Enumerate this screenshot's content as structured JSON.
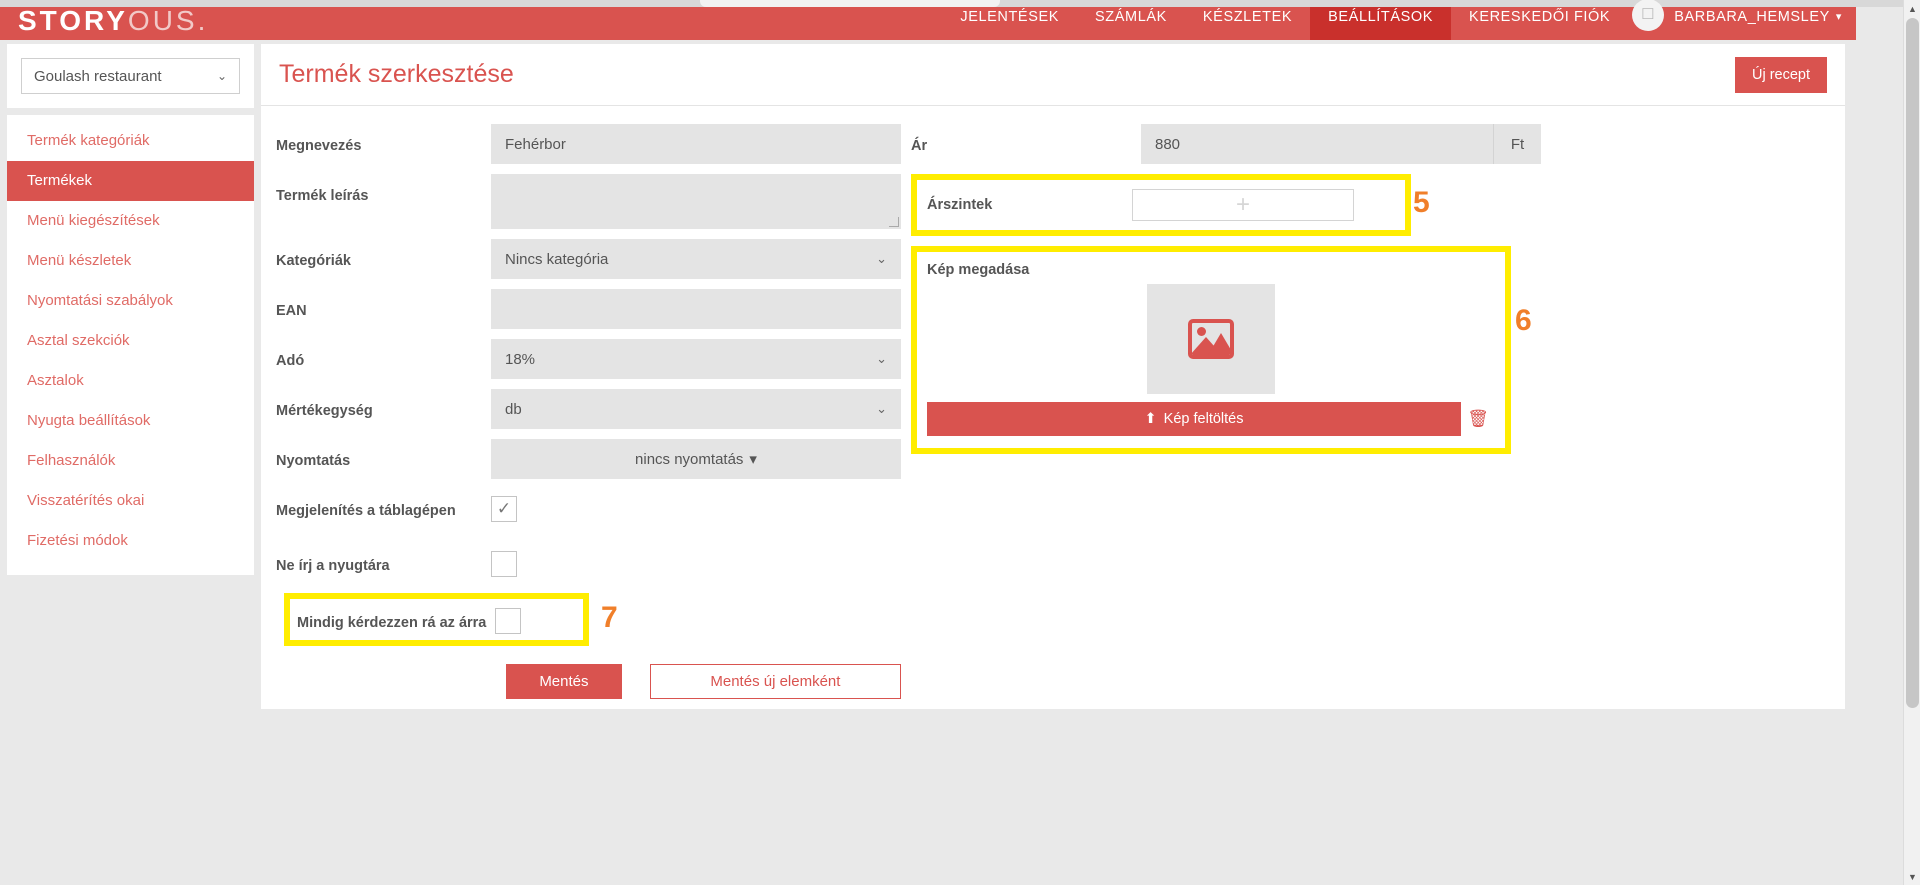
{
  "brand": {
    "logo_bold": "STORY",
    "logo_light": "OUS.",
    "accent": "#d9534f",
    "highlight": "#ffed00",
    "annotation_color": "#f07f2a"
  },
  "topnav": {
    "items": [
      {
        "label": "JELENTÉSEK",
        "active": false
      },
      {
        "label": "SZÁMLÁK",
        "active": false
      },
      {
        "label": "KÉSZLETEK",
        "active": false
      },
      {
        "label": "BEÁLLÍTÁSOK",
        "active": true
      },
      {
        "label": "KERESKEDŐI FIÓK",
        "active": false
      }
    ],
    "user": {
      "name": "BARBARA_HEMSLEY",
      "avatar_icon": "broken-image-icon",
      "caret": "▾"
    }
  },
  "restaurant_select": {
    "value": "Goulash restaurant",
    "caret": "⌄"
  },
  "sidebar": {
    "items": [
      {
        "label": "Termék kategóriák",
        "active": false
      },
      {
        "label": "Termékek",
        "active": true
      },
      {
        "label": "Menü kiegészítések",
        "active": false
      },
      {
        "label": "Menü készletek",
        "active": false
      },
      {
        "label": "Nyomtatási szabályok",
        "active": false
      },
      {
        "label": "Asztal szekciók",
        "active": false
      },
      {
        "label": "Asztalok",
        "active": false
      },
      {
        "label": "Nyugta beállítások",
        "active": false
      },
      {
        "label": "Felhasználók",
        "active": false
      },
      {
        "label": "Visszatérítés okai",
        "active": false
      },
      {
        "label": "Fizetési módok",
        "active": false
      }
    ]
  },
  "header": {
    "title": "Termék szerkesztése",
    "new_recipe_button": "Új recept"
  },
  "form": {
    "name": {
      "label": "Megnevezés",
      "value": "Fehérbor"
    },
    "description": {
      "label": "Termék leírás",
      "value": ""
    },
    "categories": {
      "label": "Kategóriák",
      "value": "Nincs kategória",
      "caret": "⌄"
    },
    "ean": {
      "label": "EAN",
      "value": ""
    },
    "tax": {
      "label": "Adó",
      "value": "18%",
      "caret": "⌄"
    },
    "unit": {
      "label": "Mértékegység",
      "value": "db",
      "caret": "⌄"
    },
    "printing": {
      "label": "Nyomtatás",
      "value": "nincs nyomtatás",
      "caret": "▾"
    },
    "show_on_tablet": {
      "label": "Megjelenítés a táblagépen",
      "checked": true,
      "check_glyph": "✓"
    },
    "no_receipt": {
      "label": "Ne írj a nyugtára",
      "checked": false,
      "check_glyph": ""
    },
    "always_ask_price": {
      "label": "Mindig kérdezzen rá az árra",
      "checked": false,
      "check_glyph": ""
    }
  },
  "right": {
    "price": {
      "label": "Ár",
      "value": "880",
      "unit": "Ft"
    },
    "price_levels": {
      "label": "Árszintek",
      "add_glyph": "+"
    },
    "image": {
      "label": "Kép megadása",
      "placeholder_icon": "image-placeholder-icon",
      "upload_button": "Kép feltöltés",
      "upload_icon": "upload-icon",
      "delete_icon": "trash-icon"
    }
  },
  "annotations": [
    {
      "number": "5",
      "target": "price-levels"
    },
    {
      "number": "6",
      "target": "image-upload"
    },
    {
      "number": "7",
      "target": "always-ask-price"
    }
  ],
  "footer": {
    "save_button": "Mentés",
    "save_as_new_button": "Mentés új elemként"
  },
  "scrollbar": {
    "up_arrow": "▲",
    "down_arrow": "▼"
  }
}
